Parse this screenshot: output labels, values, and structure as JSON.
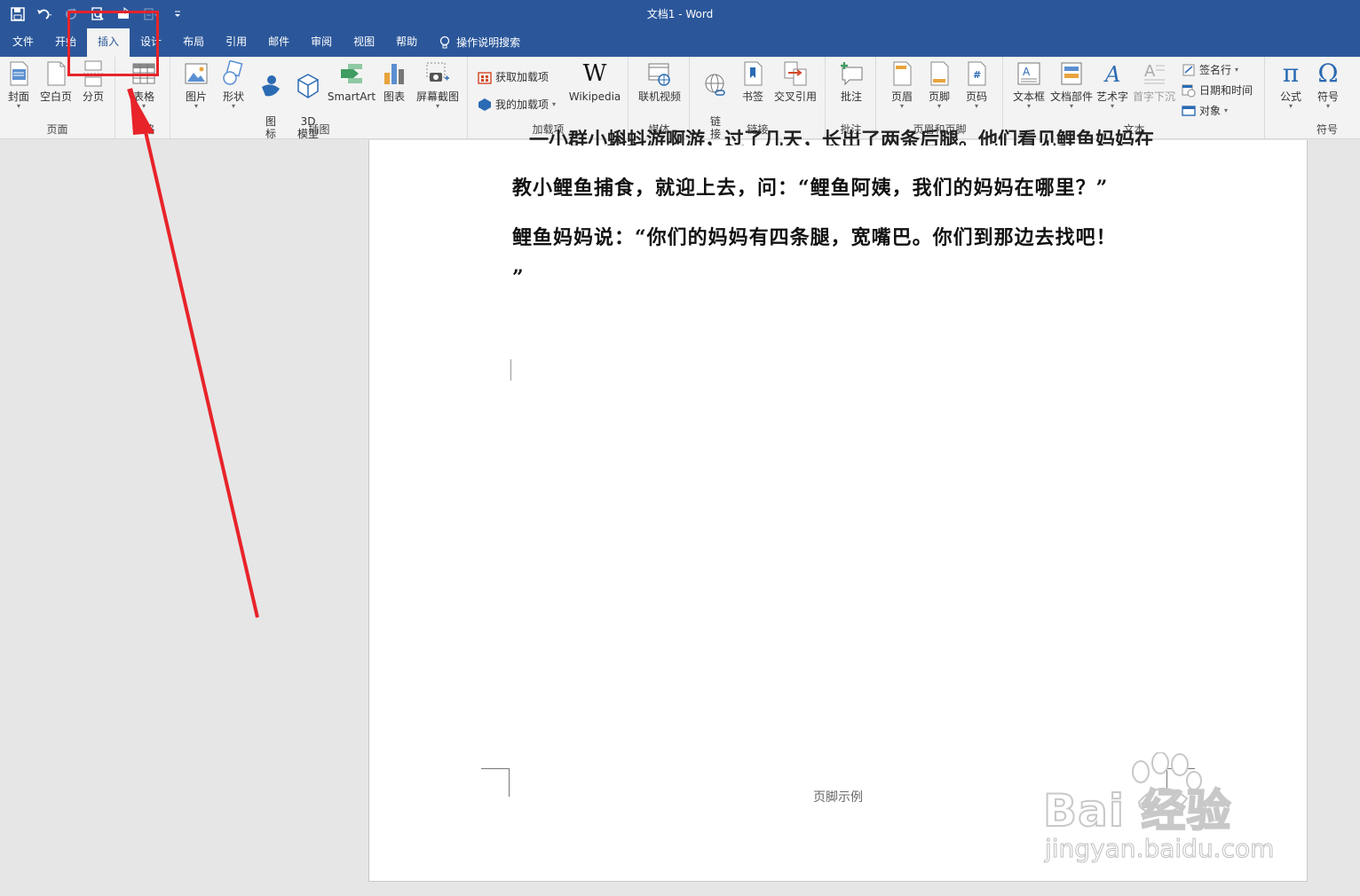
{
  "window": {
    "title": "文档1  -  Word"
  },
  "qat": {
    "save": "save-icon",
    "undo": "undo-icon",
    "redo": "redo-icon",
    "print_preview": "print-preview-icon",
    "touch": "touch-mode-icon",
    "more": "customize-icon"
  },
  "tabs": [
    {
      "label": "文件"
    },
    {
      "label": "开始"
    },
    {
      "label": "插入"
    },
    {
      "label": "设计"
    },
    {
      "label": "布局"
    },
    {
      "label": "引用"
    },
    {
      "label": "邮件"
    },
    {
      "label": "审阅"
    },
    {
      "label": "视图"
    },
    {
      "label": "帮助"
    },
    {
      "label": "操作说明搜索"
    }
  ],
  "ribbon": {
    "pages": {
      "label": "页面",
      "cover": "封面",
      "blank": "空白页",
      "break": "分页"
    },
    "tables": {
      "label": "表格",
      "table": "表格"
    },
    "illustrations": {
      "label": "插图",
      "picture": "图片",
      "shapes": "形状",
      "icons": "图\n标",
      "model3d": "3D\n模型",
      "smartart": "SmartArt",
      "chart": "图表",
      "screenshot": "屏幕截图"
    },
    "addins": {
      "label": "加载项",
      "get": "获取加载项",
      "mine": "我的加载项",
      "wiki_mark": "W",
      "wikipedia": "Wikipedia"
    },
    "media": {
      "label": "媒体",
      "video": "联机视频"
    },
    "links": {
      "label": "链接",
      "link": "链\n接",
      "bookmark": "书签",
      "crossref": "交叉引用"
    },
    "comments": {
      "label": "批注",
      "comment": "批注"
    },
    "header_footer": {
      "label": "页眉和页脚",
      "header": "页眉",
      "footer": "页脚",
      "page_number": "页码"
    },
    "text": {
      "label": "文本",
      "textbox": "文本框",
      "quickparts": "文档部件",
      "wordart": "艺术字",
      "dropcap": "首字下沉",
      "signature": "签名行",
      "datetime": "日期和时间",
      "object": "对象"
    },
    "symbols": {
      "label": "符号",
      "equation": "公式",
      "symbol": "符号",
      "pi": "π",
      "omega": "Ω"
    }
  },
  "document": {
    "cut_line": "一小群小蝌蚪游啊游，过了几天，长出了两条后腿。他们看见鲤鱼妈妈在",
    "line1": "教小鲤鱼捕食，就迎上去，问：“鲤鱼阿姨，我们的妈妈在哪里？”",
    "line2": "鲤鱼妈妈说：“你们的妈妈有四条腿，宽嘴巴。你们到那边去找吧！",
    "line3": "”",
    "footer": "页脚示例"
  },
  "watermark": {
    "brand": "Bai  经验",
    "url": "jingyan.baidu.com"
  },
  "colors": {
    "titlebar": "#2b579a",
    "ribbon": "#f3f3f3",
    "annotation": "#e8232a"
  }
}
